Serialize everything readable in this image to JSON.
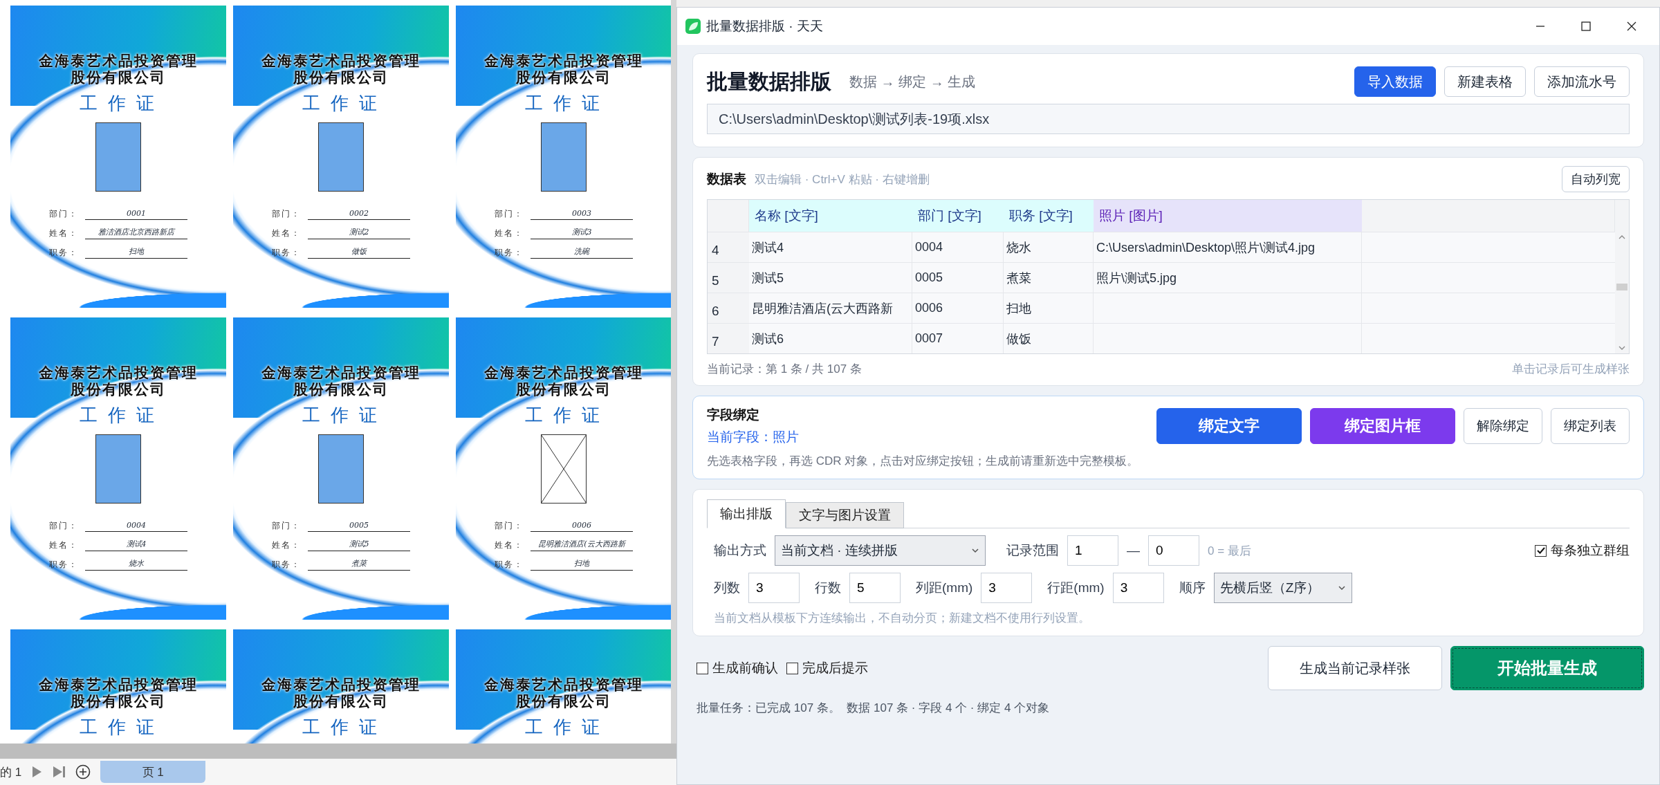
{
  "document": {
    "cards": [
      {
        "kind": "photo",
        "company": [
          "金海泰艺术品投资管理",
          "股份有限公司"
        ],
        "title": "工 作 证",
        "fields": [
          {
            "label": "部门：",
            "value": "0001"
          },
          {
            "label": "姓名：",
            "value": "雅洁酒店北京西路新店"
          },
          {
            "label": "职务：",
            "value": "扫地"
          }
        ]
      },
      {
        "kind": "photo",
        "company": [
          "金海泰艺术品投资管理",
          "股份有限公司"
        ],
        "title": "工 作 证",
        "fields": [
          {
            "label": "部门：",
            "value": "0002"
          },
          {
            "label": "姓名：",
            "value": "测试2"
          },
          {
            "label": "职务：",
            "value": "做饭"
          }
        ]
      },
      {
        "kind": "photo",
        "company": [
          "金海泰艺术品投资管理",
          "股份有限公司"
        ],
        "title": "工 作 证",
        "fields": [
          {
            "label": "部门：",
            "value": "0003"
          },
          {
            "label": "姓名：",
            "value": "测试3"
          },
          {
            "label": "职务：",
            "value": "洗碗"
          }
        ]
      },
      {
        "kind": "photo",
        "company": [
          "金海泰艺术品投资管理",
          "股份有限公司"
        ],
        "title": "工 作 证",
        "fields": [
          {
            "label": "部门：",
            "value": "0004"
          },
          {
            "label": "姓名：",
            "value": "测试4"
          },
          {
            "label": "职务：",
            "value": "烧水"
          }
        ]
      },
      {
        "kind": "photo",
        "company": [
          "金海泰艺术品投资管理",
          "股份有限公司"
        ],
        "title": "工 作 证",
        "fields": [
          {
            "label": "部门：",
            "value": "0005"
          },
          {
            "label": "姓名：",
            "value": "测试5"
          },
          {
            "label": "职务：",
            "value": "煮菜"
          }
        ]
      },
      {
        "kind": "empty-frame",
        "company": [
          "金海泰艺术品投资管理",
          "股份有限公司"
        ],
        "title": "工 作 证",
        "fields": [
          {
            "label": "部门：",
            "value": "0006"
          },
          {
            "label": "姓名：",
            "value": "昆明雅洁酒店(云大西路新"
          },
          {
            "label": "职务：",
            "value": "扫地"
          }
        ]
      },
      {
        "kind": "cut",
        "company": [
          "金海泰艺术品投资管理",
          "股份有限公司"
        ],
        "title": "工 作 证"
      },
      {
        "kind": "cut",
        "company": [
          "金海泰艺术品投资管理",
          "股份有限公司"
        ],
        "title": "工 作 证"
      },
      {
        "kind": "cut",
        "company": [
          "金海泰艺术品投资管理",
          "股份有限公司"
        ],
        "title": "工 作 证"
      }
    ]
  },
  "page_nav": {
    "count": "的 1",
    "tab": "页 1"
  },
  "window": {
    "title": "批量数据排版 · 天天"
  },
  "header": {
    "title": "批量数据排版",
    "subtitle": "数据 → 绑定 → 生成",
    "buttons": [
      {
        "label": "导入数据",
        "primary": true
      },
      {
        "label": "新建表格",
        "primary": false
      },
      {
        "label": "添加流水号",
        "primary": false
      }
    ],
    "path": "C:\\Users\\admin\\Desktop\\测试列表-19项.xlsx"
  },
  "data_table": {
    "title": "数据表",
    "hint": "双击编辑 · Ctrl+V 粘贴 · 右键增删",
    "button": "自动列宽",
    "columns": [
      {
        "label": "名称 [文字]",
        "kind": "text"
      },
      {
        "label": "部门 [文字]",
        "kind": "text"
      },
      {
        "label": "职务 [文字]",
        "kind": "text"
      },
      {
        "label": "照片 [图片]",
        "kind": "image"
      }
    ],
    "rows": [
      {
        "index": "4",
        "cells": [
          "测试4",
          "0004",
          "烧水",
          "C:\\Users\\admin\\Desktop\\照片\\测试4.jpg"
        ]
      },
      {
        "index": "5",
        "cells": [
          "测试5",
          "0005",
          "煮菜",
          "照片\\测试5.jpg"
        ]
      },
      {
        "index": "6",
        "cells": [
          "昆明雅洁酒店(云大西路新",
          "0006",
          "扫地",
          ""
        ]
      },
      {
        "index": "7",
        "cells": [
          "测试6",
          "0007",
          "做饭",
          ""
        ]
      }
    ],
    "record": "当前记录：第 1 条 / 共 107 条",
    "record_hint": "单击记录后可生成样张"
  },
  "binding": {
    "title": "字段绑定",
    "current": "当前字段：照片",
    "buttons": [
      {
        "label": "绑定文字",
        "kind": "blue"
      },
      {
        "label": "绑定图片框",
        "kind": "purple"
      },
      {
        "label": "解除绑定",
        "kind": "plain"
      },
      {
        "label": "绑定列表",
        "kind": "plain"
      }
    ],
    "hint": "先选表格字段，再选 CDR 对象，点击对应绑定按钮；生成前请重新选中完整模板。"
  },
  "output": {
    "tabs": [
      {
        "label": "输出排版",
        "selected": true
      },
      {
        "label": "文字与图片设置",
        "selected": false
      }
    ],
    "mode_label": "输出方式",
    "mode": "当前文档 · 连续拼版",
    "range_label": "记录范围",
    "range_from": "1",
    "range_dash": "—",
    "range_to": "0",
    "range_hint": "0 = 最后",
    "group": {
      "label": "每条独立群组",
      "checked": true
    },
    "grid": [
      {
        "label": "列数",
        "value": "3"
      },
      {
        "label": "行数",
        "value": "5"
      },
      {
        "label": "列距(mm)",
        "value": "3"
      },
      {
        "label": "行距(mm)",
        "value": "3"
      }
    ],
    "order_label": "顺序",
    "order": "先横后竖（Z序）",
    "note": "当前文档从模板下方连续输出，不自动分页；新建文档不使用行列设置。"
  },
  "footer": {
    "options": [
      {
        "label": "生成前确认",
        "checked": false
      },
      {
        "label": "完成后提示",
        "checked": false
      }
    ],
    "sample_button": "生成当前记录样张",
    "start_button": "开始批量生成",
    "status": "批量任务：已完成 107 条。  数据 107 条 · 字段 4 个 · 绑定 4 个对象"
  }
}
